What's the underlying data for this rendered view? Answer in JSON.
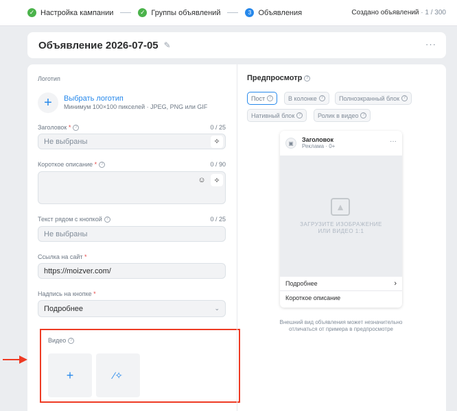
{
  "stepper": {
    "steps": [
      {
        "label": "Настройка кампании",
        "state": "done"
      },
      {
        "label": "Группы объявлений",
        "state": "done"
      },
      {
        "label": "Объявления",
        "state": "current",
        "number": "3"
      }
    ],
    "created_label": "Создано объявлений",
    "created_count": "· 1 / 300"
  },
  "title": {
    "text": "Объявление 2026-07-05",
    "more": "···"
  },
  "form": {
    "logo_label": "Логотип",
    "logo_link": "Выбрать логотип",
    "logo_hint": "Минимум 100×100 пикселей · JPEG, PNG или GIF",
    "headline_label": "Заголовок",
    "headline_counter": "0 / 25",
    "headline_placeholder": "Не выбраны",
    "short_desc_label": "Короткое описание",
    "short_desc_counter": "0 / 90",
    "button_text_label": "Текст рядом с кнопкой",
    "button_text_counter": "0 / 25",
    "button_text_placeholder": "Не выбраны",
    "url_label": "Ссылка на сайт",
    "url_value": "https://moizver.com/",
    "cta_label": "Надпись на кнопке",
    "cta_value": "Подробнее",
    "video_label": "Видео"
  },
  "preview": {
    "title": "Предпросмотр",
    "chips": [
      {
        "label": "Пост",
        "active": true
      },
      {
        "label": "В колонке",
        "active": false
      },
      {
        "label": "Полноэкранный блок",
        "active": false
      },
      {
        "label": "Нативный блок",
        "active": false
      },
      {
        "label": "Ролик в видео",
        "active": false
      }
    ],
    "ad_name": "Заголовок",
    "ad_sub": "Реклама · 0+",
    "image_placeholder": "ЗАГРУЗИТЕ ИЗОБРАЖЕНИЕ ИЛИ ВИДЕО 1:1",
    "more_label": "Подробнее",
    "short_desc": "Короткое описание",
    "note": "Внешний вид объявления может незначительно отличаться от примера в предпросмотре"
  },
  "colors": {
    "accent": "#2688eb",
    "success": "#4bb34b",
    "highlight": "#ee3a23"
  }
}
